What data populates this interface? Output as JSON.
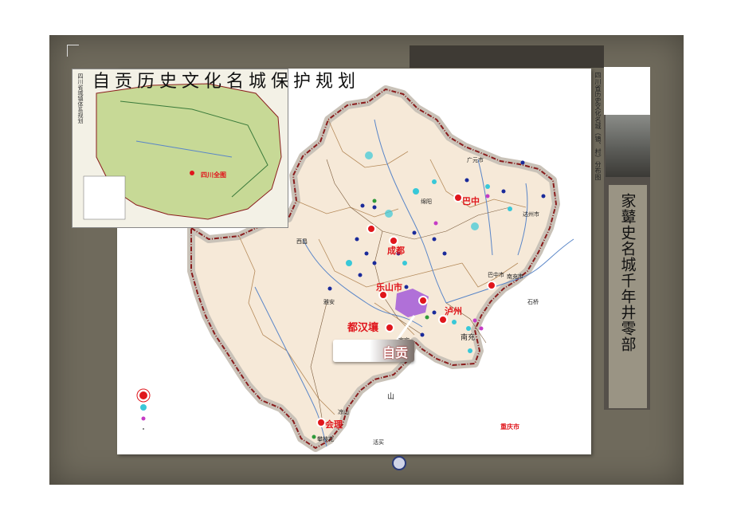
{
  "slide": {
    "title": "自贡历史文化名城保护规划",
    "vertical_title": "家鼙史名城千年井零部",
    "map_caption": "四川省历史文化名城（镇、村）分布图",
    "inset_title": "四川省城镇体系规划",
    "inset_label": "四川全图",
    "callout": "自贡"
  },
  "map": {
    "red_city_labels": [
      {
        "name": "巴中",
        "key": "bazhong"
      },
      {
        "name": "成都",
        "key": "chengdu"
      },
      {
        "name": "乐山市",
        "key": "leshan"
      },
      {
        "name": "都汉壤",
        "key": "duhanrang"
      },
      {
        "name": "泸州",
        "key": "luzhou"
      },
      {
        "name": "会理",
        "key": "huili"
      },
      {
        "name": "重庆市",
        "key": "chongqing"
      }
    ],
    "place_labels": [
      {
        "name": "广元市",
        "key": "guangyuan"
      },
      {
        "name": "绵阳",
        "key": "mianyang"
      },
      {
        "name": "达州市",
        "key": "dazhou"
      },
      {
        "name": "巴中市",
        "key": "bazhongshi"
      },
      {
        "name": "南充",
        "key": "nanchong"
      },
      {
        "name": "石桥",
        "key": "shiqiao"
      },
      {
        "name": "雅安",
        "key": "yaan"
      },
      {
        "name": "宜宾",
        "key": "yibin"
      },
      {
        "name": "攀枝花",
        "key": "panzhihua"
      },
      {
        "name": "西昌",
        "key": "xichang"
      },
      {
        "name": "山",
        "key": "shan"
      },
      {
        "name": "活买",
        "key": "huomai"
      },
      {
        "name": "凉山",
        "key": "liangshan"
      },
      {
        "name": "南充市",
        "key": "nanchongshi"
      }
    ]
  },
  "legend": {
    "items": [
      {
        "symbol": "red-target-icon",
        "label": ""
      },
      {
        "symbol": "cyan-dot-icon",
        "label": ""
      },
      {
        "symbol": "magenta-dot-icon",
        "label": ""
      },
      {
        "symbol": "small-dot-icon",
        "label": ""
      }
    ]
  },
  "colors": {
    "background_frame": "#6f6a5c",
    "map_land": "#f6e9d8",
    "province_border": "#8a1c1c",
    "river": "#5a86c8",
    "red_city": "#e0161c",
    "cyan_site": "#38c8d8",
    "magenta_site": "#c53bc5",
    "blue_site": "#1a2a9a",
    "green_site": "#2e9a3a",
    "zigong_highlight": "#a35ad8"
  }
}
